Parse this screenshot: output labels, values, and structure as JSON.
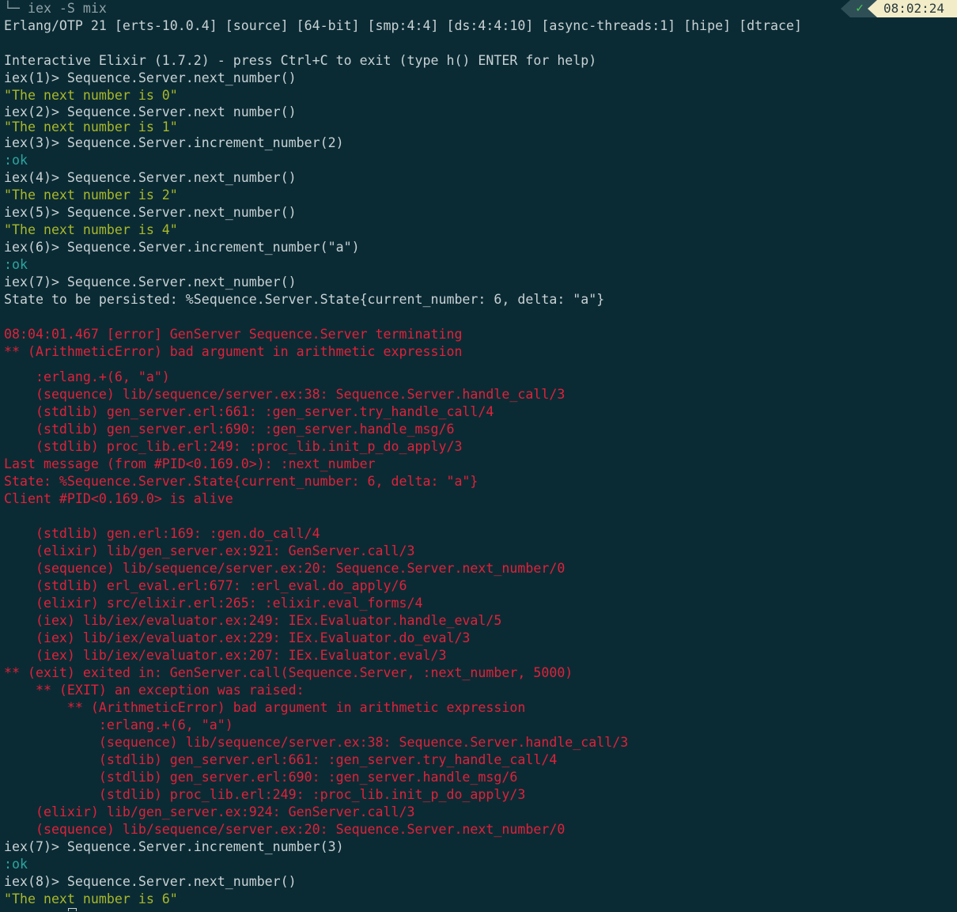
{
  "status": {
    "ok_icon": "check-icon",
    "ok_glyph": "✓",
    "time": "08:02:24",
    "ok_color": "#48d04e"
  },
  "colors": {
    "background": "#0b2b34",
    "text": "#c8d2d5",
    "string": "#a8b82a",
    "atom": "#2aa6a0",
    "error": "#e0213a"
  },
  "terminal": {
    "lines": [
      {
        "kind": "dim",
        "text": "└─ iex -S mix"
      },
      {
        "kind": "default",
        "text": "Erlang/OTP 21 [erts-10.0.4] [source] [64-bit] [smp:4:4] [ds:4:4:10] [async-threads:1] [hipe] [dtrace]"
      },
      {
        "kind": "default",
        "text": ""
      },
      {
        "kind": "default",
        "text": "Interactive Elixir (1.7.2) - press Ctrl+C to exit (type h() ENTER for help)"
      },
      {
        "kind": "default",
        "text": "iex(1)> Sequence.Server.next_number()"
      },
      {
        "kind": "string",
        "text": "\"The next number is 0\""
      },
      {
        "kind": "default",
        "text": "iex(2)> Sequence.Server.next number()",
        "tight": true
      },
      {
        "kind": "string",
        "text": "\"The next number is 1\"",
        "tight": true
      },
      {
        "kind": "default",
        "text": "iex(3)> Sequence.Server.increment_number(2)"
      },
      {
        "kind": "atom",
        "text": ":ok"
      },
      {
        "kind": "default",
        "text": "iex(4)> Sequence.Server.next_number()"
      },
      {
        "kind": "string",
        "text": "\"The next number is 2\""
      },
      {
        "kind": "default",
        "text": "iex(5)> Sequence.Server.next_number()"
      },
      {
        "kind": "string",
        "text": "\"The next number is 4\""
      },
      {
        "kind": "default",
        "text": "iex(6)> Sequence.Server.increment_number(\"a\")"
      },
      {
        "kind": "atom",
        "text": ":ok"
      },
      {
        "kind": "default",
        "text": "iex(7)> Sequence.Server.next_number()"
      },
      {
        "kind": "default",
        "text": "State to be persisted: %Sequence.Server.State{current_number: 6, delta: \"a\"}"
      },
      {
        "kind": "default",
        "text": ""
      },
      {
        "kind": "error",
        "text": "08:04:01.467 [error] GenServer Sequence.Server terminating"
      },
      {
        "kind": "error",
        "text": "** (ArithmeticError) bad argument in arithmetic expression"
      },
      {
        "kind": "error",
        "text": "",
        "cut": true
      },
      {
        "kind": "error",
        "text": "    :erlang.+(6, \"a\")"
      },
      {
        "kind": "error",
        "text": "    (sequence) lib/sequence/server.ex:38: Sequence.Server.handle_call/3"
      },
      {
        "kind": "error",
        "text": "    (stdlib) gen_server.erl:661: :gen_server.try_handle_call/4"
      },
      {
        "kind": "error",
        "text": "    (stdlib) gen_server.erl:690: :gen_server.handle_msg/6"
      },
      {
        "kind": "error",
        "text": "    (stdlib) proc_lib.erl:249: :proc_lib.init_p_do_apply/3"
      },
      {
        "kind": "error",
        "text": "Last message (from #PID<0.169.0>): :next_number"
      },
      {
        "kind": "error",
        "text": "State: %Sequence.Server.State{current_number: 6, delta: \"a\"}"
      },
      {
        "kind": "error",
        "text": "Client #PID<0.169.0> is alive"
      },
      {
        "kind": "error",
        "text": ""
      },
      {
        "kind": "error",
        "text": "    (stdlib) gen.erl:169: :gen.do_call/4"
      },
      {
        "kind": "error",
        "text": "    (elixir) lib/gen_server.ex:921: GenServer.call/3"
      },
      {
        "kind": "error",
        "text": "    (sequence) lib/sequence/server.ex:20: Sequence.Server.next_number/0"
      },
      {
        "kind": "error",
        "text": "    (stdlib) erl_eval.erl:677: :erl_eval.do_apply/6"
      },
      {
        "kind": "error",
        "text": "    (elixir) src/elixir.erl:265: :elixir.eval_forms/4"
      },
      {
        "kind": "error",
        "text": "    (iex) lib/iex/evaluator.ex:249: IEx.Evaluator.handle_eval/5"
      },
      {
        "kind": "error",
        "text": "    (iex) lib/iex/evaluator.ex:229: IEx.Evaluator.do_eval/3"
      },
      {
        "kind": "error",
        "text": "    (iex) lib/iex/evaluator.ex:207: IEx.Evaluator.eval/3"
      },
      {
        "kind": "error",
        "text": "** (exit) exited in: GenServer.call(Sequence.Server, :next_number, 5000)"
      },
      {
        "kind": "error",
        "text": "    ** (EXIT) an exception was raised:"
      },
      {
        "kind": "error",
        "text": "        ** (ArithmeticError) bad argument in arithmetic expression"
      },
      {
        "kind": "error",
        "text": "            :erlang.+(6, \"a\")"
      },
      {
        "kind": "error",
        "text": "            (sequence) lib/sequence/server.ex:38: Sequence.Server.handle_call/3"
      },
      {
        "kind": "error",
        "text": "            (stdlib) gen_server.erl:661: :gen_server.try_handle_call/4"
      },
      {
        "kind": "error",
        "text": "            (stdlib) gen_server.erl:690: :gen_server.handle_msg/6"
      },
      {
        "kind": "error",
        "text": "            (stdlib) proc_lib.erl:249: :proc_lib.init_p_do_apply/3"
      },
      {
        "kind": "error",
        "text": "    (elixir) lib/gen_server.ex:924: GenServer.call/3"
      },
      {
        "kind": "error",
        "text": "    (sequence) lib/sequence/server.ex:20: Sequence.Server.next_number/0"
      },
      {
        "kind": "default",
        "text": "iex(7)> Sequence.Server.increment_number(3)"
      },
      {
        "kind": "atom",
        "text": ":ok"
      },
      {
        "kind": "default",
        "text": "iex(8)> Sequence.Server.next_number()"
      },
      {
        "kind": "string",
        "text": "\"The next number is 6\""
      }
    ]
  }
}
